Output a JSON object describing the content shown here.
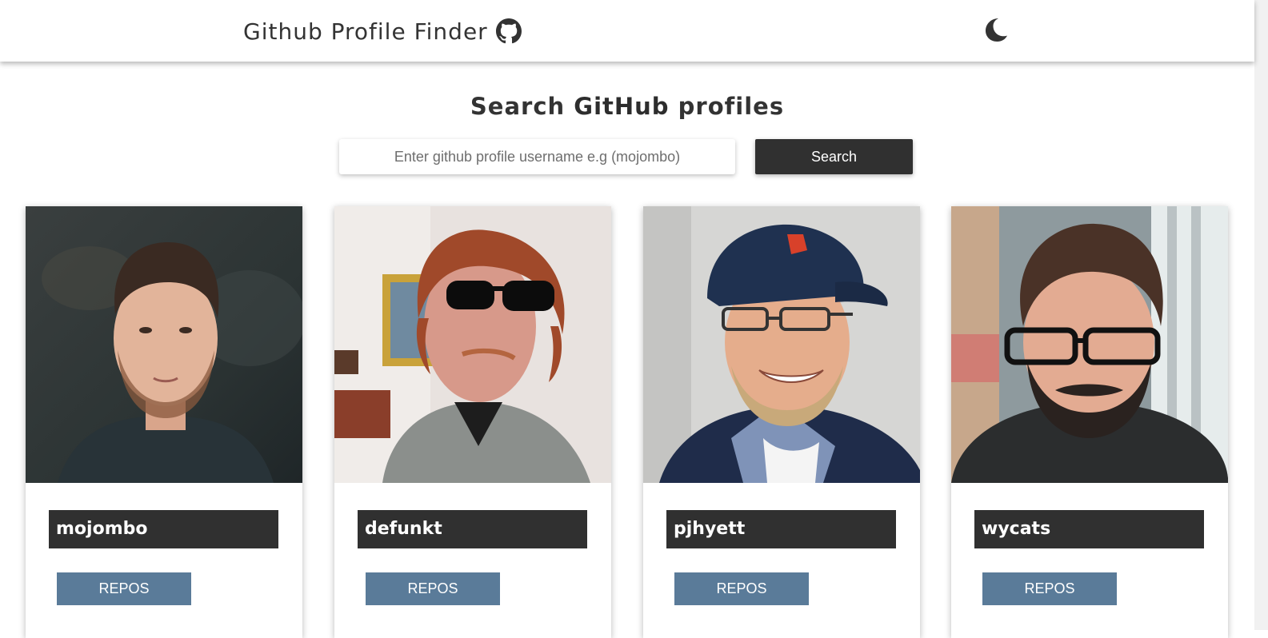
{
  "header": {
    "title": "Github Profile Finder",
    "logo_icon": "github-icon",
    "theme_icon": "moon-icon"
  },
  "search": {
    "title_prefix": "Search",
    "title_bold": "GitHub",
    "title_suffix": "profiles",
    "placeholder": "Enter github profile username e.g (mojombo)",
    "value": "",
    "button_label": "Search"
  },
  "profiles": [
    {
      "username": "mojombo",
      "repos_label": "REPOS"
    },
    {
      "username": "defunkt",
      "repos_label": "REPOS"
    },
    {
      "username": "pjhyett",
      "repos_label": "REPOS"
    },
    {
      "username": "wycats",
      "repos_label": "REPOS"
    }
  ],
  "colors": {
    "dark": "#303030",
    "repos_button": "#5a7b99",
    "background": "#ffffff"
  }
}
